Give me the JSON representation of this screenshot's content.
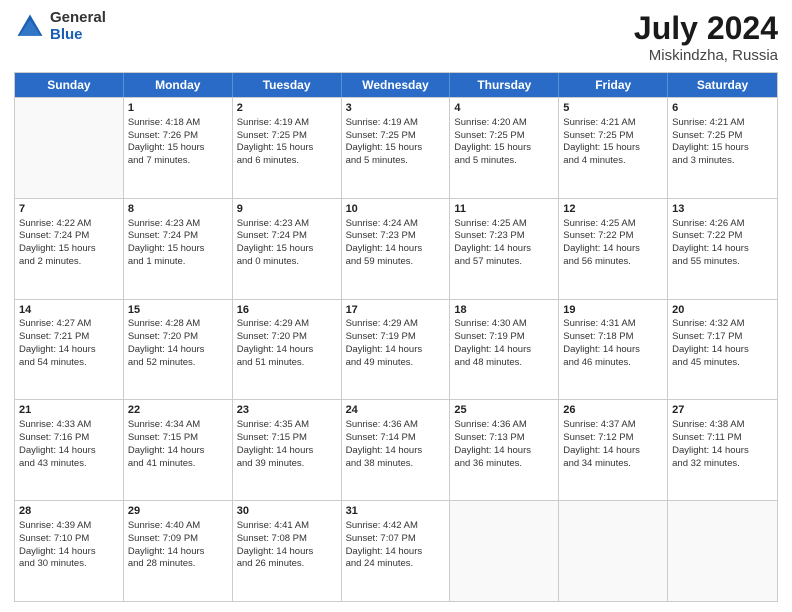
{
  "logo": {
    "general": "General",
    "blue": "Blue"
  },
  "title": {
    "month": "July 2024",
    "location": "Miskindzha, Russia"
  },
  "header_days": [
    "Sunday",
    "Monday",
    "Tuesday",
    "Wednesday",
    "Thursday",
    "Friday",
    "Saturday"
  ],
  "weeks": [
    [
      {
        "day": "",
        "lines": []
      },
      {
        "day": "1",
        "lines": [
          "Sunrise: 4:18 AM",
          "Sunset: 7:26 PM",
          "Daylight: 15 hours",
          "and 7 minutes."
        ]
      },
      {
        "day": "2",
        "lines": [
          "Sunrise: 4:19 AM",
          "Sunset: 7:25 PM",
          "Daylight: 15 hours",
          "and 6 minutes."
        ]
      },
      {
        "day": "3",
        "lines": [
          "Sunrise: 4:19 AM",
          "Sunset: 7:25 PM",
          "Daylight: 15 hours",
          "and 5 minutes."
        ]
      },
      {
        "day": "4",
        "lines": [
          "Sunrise: 4:20 AM",
          "Sunset: 7:25 PM",
          "Daylight: 15 hours",
          "and 5 minutes."
        ]
      },
      {
        "day": "5",
        "lines": [
          "Sunrise: 4:21 AM",
          "Sunset: 7:25 PM",
          "Daylight: 15 hours",
          "and 4 minutes."
        ]
      },
      {
        "day": "6",
        "lines": [
          "Sunrise: 4:21 AM",
          "Sunset: 7:25 PM",
          "Daylight: 15 hours",
          "and 3 minutes."
        ]
      }
    ],
    [
      {
        "day": "7",
        "lines": [
          "Sunrise: 4:22 AM",
          "Sunset: 7:24 PM",
          "Daylight: 15 hours",
          "and 2 minutes."
        ]
      },
      {
        "day": "8",
        "lines": [
          "Sunrise: 4:23 AM",
          "Sunset: 7:24 PM",
          "Daylight: 15 hours",
          "and 1 minute."
        ]
      },
      {
        "day": "9",
        "lines": [
          "Sunrise: 4:23 AM",
          "Sunset: 7:24 PM",
          "Daylight: 15 hours",
          "and 0 minutes."
        ]
      },
      {
        "day": "10",
        "lines": [
          "Sunrise: 4:24 AM",
          "Sunset: 7:23 PM",
          "Daylight: 14 hours",
          "and 59 minutes."
        ]
      },
      {
        "day": "11",
        "lines": [
          "Sunrise: 4:25 AM",
          "Sunset: 7:23 PM",
          "Daylight: 14 hours",
          "and 57 minutes."
        ]
      },
      {
        "day": "12",
        "lines": [
          "Sunrise: 4:25 AM",
          "Sunset: 7:22 PM",
          "Daylight: 14 hours",
          "and 56 minutes."
        ]
      },
      {
        "day": "13",
        "lines": [
          "Sunrise: 4:26 AM",
          "Sunset: 7:22 PM",
          "Daylight: 14 hours",
          "and 55 minutes."
        ]
      }
    ],
    [
      {
        "day": "14",
        "lines": [
          "Sunrise: 4:27 AM",
          "Sunset: 7:21 PM",
          "Daylight: 14 hours",
          "and 54 minutes."
        ]
      },
      {
        "day": "15",
        "lines": [
          "Sunrise: 4:28 AM",
          "Sunset: 7:20 PM",
          "Daylight: 14 hours",
          "and 52 minutes."
        ]
      },
      {
        "day": "16",
        "lines": [
          "Sunrise: 4:29 AM",
          "Sunset: 7:20 PM",
          "Daylight: 14 hours",
          "and 51 minutes."
        ]
      },
      {
        "day": "17",
        "lines": [
          "Sunrise: 4:29 AM",
          "Sunset: 7:19 PM",
          "Daylight: 14 hours",
          "and 49 minutes."
        ]
      },
      {
        "day": "18",
        "lines": [
          "Sunrise: 4:30 AM",
          "Sunset: 7:19 PM",
          "Daylight: 14 hours",
          "and 48 minutes."
        ]
      },
      {
        "day": "19",
        "lines": [
          "Sunrise: 4:31 AM",
          "Sunset: 7:18 PM",
          "Daylight: 14 hours",
          "and 46 minutes."
        ]
      },
      {
        "day": "20",
        "lines": [
          "Sunrise: 4:32 AM",
          "Sunset: 7:17 PM",
          "Daylight: 14 hours",
          "and 45 minutes."
        ]
      }
    ],
    [
      {
        "day": "21",
        "lines": [
          "Sunrise: 4:33 AM",
          "Sunset: 7:16 PM",
          "Daylight: 14 hours",
          "and 43 minutes."
        ]
      },
      {
        "day": "22",
        "lines": [
          "Sunrise: 4:34 AM",
          "Sunset: 7:15 PM",
          "Daylight: 14 hours",
          "and 41 minutes."
        ]
      },
      {
        "day": "23",
        "lines": [
          "Sunrise: 4:35 AM",
          "Sunset: 7:15 PM",
          "Daylight: 14 hours",
          "and 39 minutes."
        ]
      },
      {
        "day": "24",
        "lines": [
          "Sunrise: 4:36 AM",
          "Sunset: 7:14 PM",
          "Daylight: 14 hours",
          "and 38 minutes."
        ]
      },
      {
        "day": "25",
        "lines": [
          "Sunrise: 4:36 AM",
          "Sunset: 7:13 PM",
          "Daylight: 14 hours",
          "and 36 minutes."
        ]
      },
      {
        "day": "26",
        "lines": [
          "Sunrise: 4:37 AM",
          "Sunset: 7:12 PM",
          "Daylight: 14 hours",
          "and 34 minutes."
        ]
      },
      {
        "day": "27",
        "lines": [
          "Sunrise: 4:38 AM",
          "Sunset: 7:11 PM",
          "Daylight: 14 hours",
          "and 32 minutes."
        ]
      }
    ],
    [
      {
        "day": "28",
        "lines": [
          "Sunrise: 4:39 AM",
          "Sunset: 7:10 PM",
          "Daylight: 14 hours",
          "and 30 minutes."
        ]
      },
      {
        "day": "29",
        "lines": [
          "Sunrise: 4:40 AM",
          "Sunset: 7:09 PM",
          "Daylight: 14 hours",
          "and 28 minutes."
        ]
      },
      {
        "day": "30",
        "lines": [
          "Sunrise: 4:41 AM",
          "Sunset: 7:08 PM",
          "Daylight: 14 hours",
          "and 26 minutes."
        ]
      },
      {
        "day": "31",
        "lines": [
          "Sunrise: 4:42 AM",
          "Sunset: 7:07 PM",
          "Daylight: 14 hours",
          "and 24 minutes."
        ]
      },
      {
        "day": "",
        "lines": []
      },
      {
        "day": "",
        "lines": []
      },
      {
        "day": "",
        "lines": []
      }
    ]
  ]
}
